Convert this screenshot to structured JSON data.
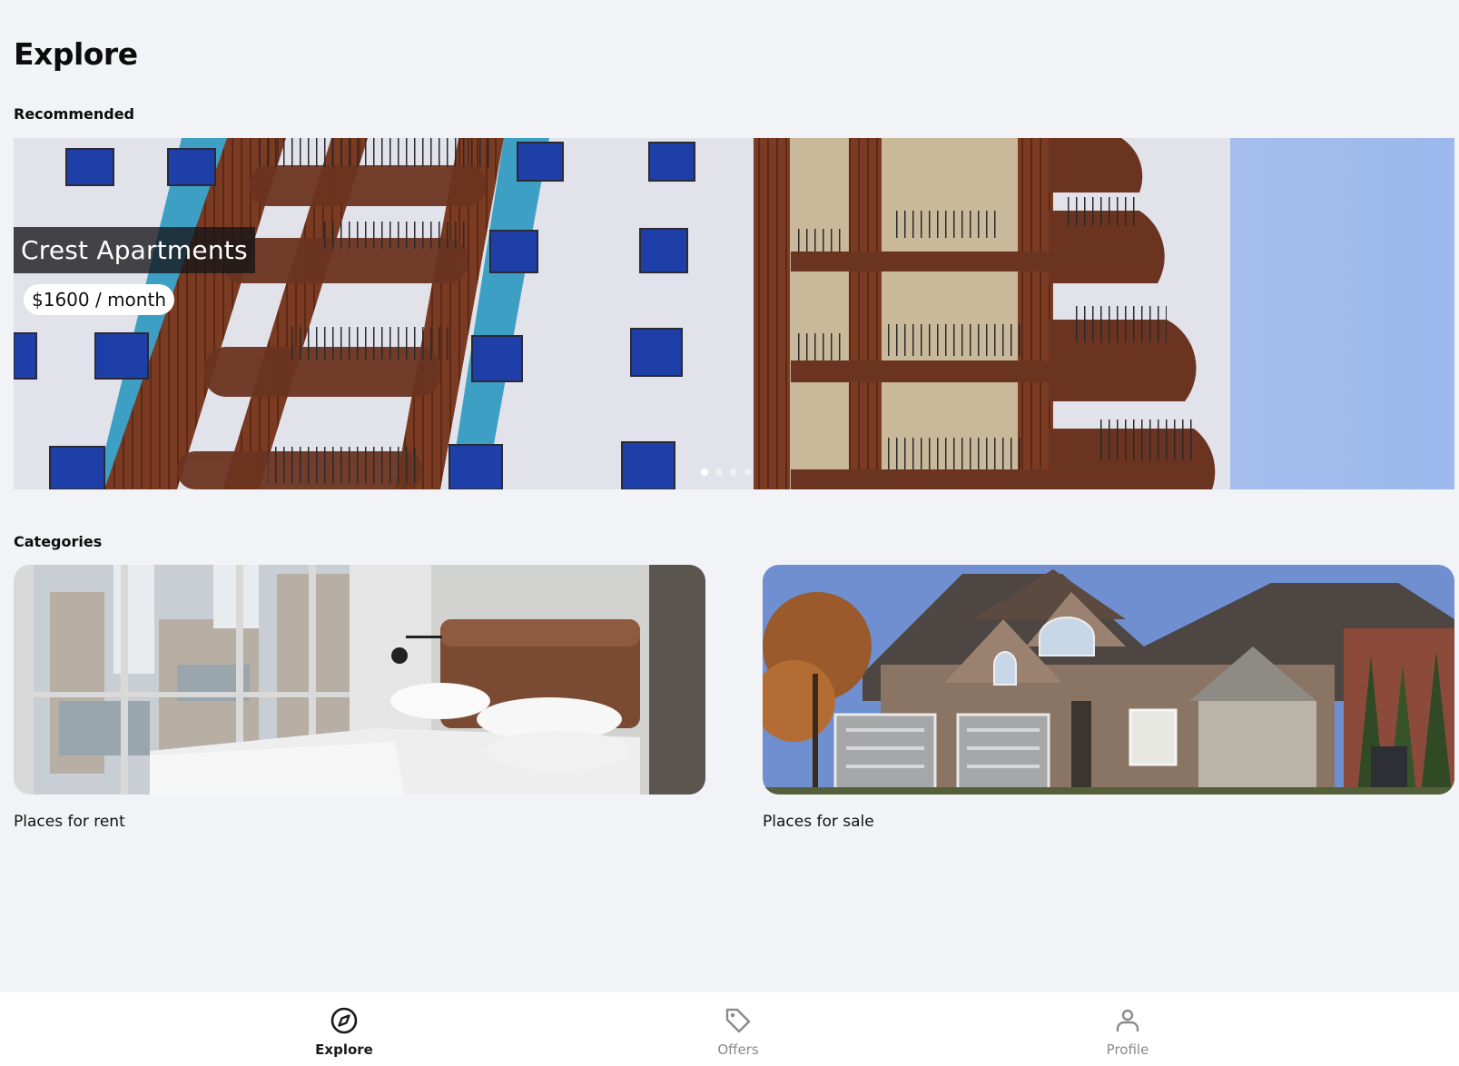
{
  "page": {
    "title": "Explore"
  },
  "recommended": {
    "heading": "Recommended",
    "slide": {
      "name": "Crest Apartments",
      "price": "$1600 / month"
    },
    "pager": {
      "count": 4,
      "active_index": 0
    }
  },
  "categories": {
    "heading": "Categories",
    "items": [
      {
        "label": "Places for rent"
      },
      {
        "label": "Places for sale"
      }
    ]
  },
  "bottom_nav": {
    "items": [
      {
        "label": "Explore",
        "icon": "compass-icon",
        "active": true
      },
      {
        "label": "Offers",
        "icon": "tag-icon",
        "active": false
      },
      {
        "label": "Profile",
        "icon": "person-icon",
        "active": false
      }
    ]
  }
}
